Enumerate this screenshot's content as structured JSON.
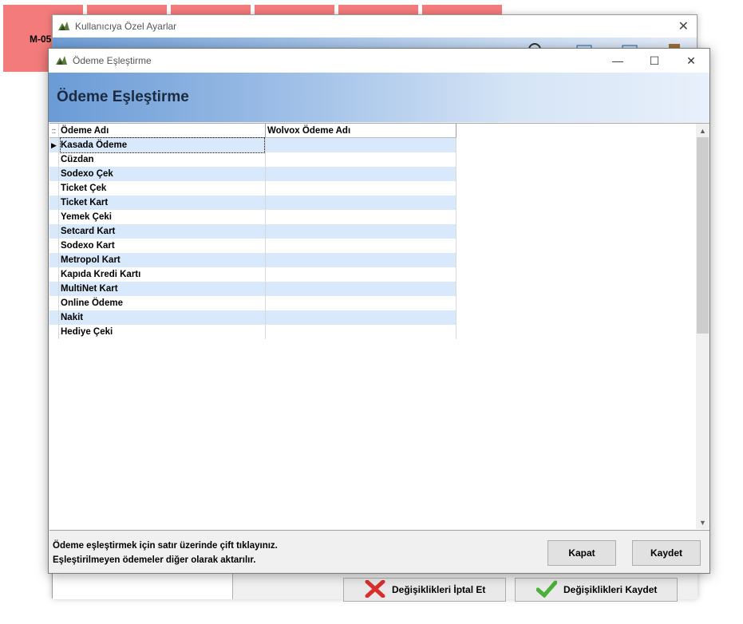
{
  "background": {
    "tile_label": "M-05"
  },
  "back_window": {
    "title": "Kullanıcıya Özel Ayarlar",
    "buttons": {
      "cancel_changes": "Değişiklikleri İptal Et",
      "save_changes": "Değişiklikleri Kaydet"
    }
  },
  "window": {
    "title": "Ödeme Eşleştirme",
    "header": "Ödeme Eşleştirme",
    "controls": {
      "minimize": "—",
      "maximize": "☐",
      "close": "✕"
    }
  },
  "grid": {
    "indicator": "::",
    "columns": [
      "Ödeme Adı",
      "Wolvox Ödeme Adı"
    ],
    "rows": [
      {
        "name": "Kasada Ödeme",
        "wolvox": ""
      },
      {
        "name": "Cüzdan",
        "wolvox": ""
      },
      {
        "name": "Sodexo Çek",
        "wolvox": ""
      },
      {
        "name": "Ticket Çek",
        "wolvox": ""
      },
      {
        "name": "Ticket Kart",
        "wolvox": ""
      },
      {
        "name": "Yemek Çeki",
        "wolvox": ""
      },
      {
        "name": "Setcard Kart",
        "wolvox": ""
      },
      {
        "name": "Sodexo Kart",
        "wolvox": ""
      },
      {
        "name": "Metropol Kart",
        "wolvox": ""
      },
      {
        "name": "Kapıda Kredi Kartı",
        "wolvox": ""
      },
      {
        "name": "MultiNet Kart",
        "wolvox": ""
      },
      {
        "name": "Online Ödeme",
        "wolvox": ""
      },
      {
        "name": "Nakit",
        "wolvox": ""
      },
      {
        "name": "Hediye Çeki",
        "wolvox": ""
      }
    ],
    "selected_index": 0
  },
  "footer": {
    "hint_line1": "Ödeme eşleştirmek için satır üzerinde çift tıklayınız.",
    "hint_line2": "Eşleştirilmeyen ödemeler diğer olarak aktarılır.",
    "close_label": "Kapat",
    "save_label": "Kaydet"
  },
  "colors": {
    "alt_row": "#d7e9fb",
    "header_gradient_start": "#6a9bd6",
    "background_tile": "#f47b7b"
  }
}
